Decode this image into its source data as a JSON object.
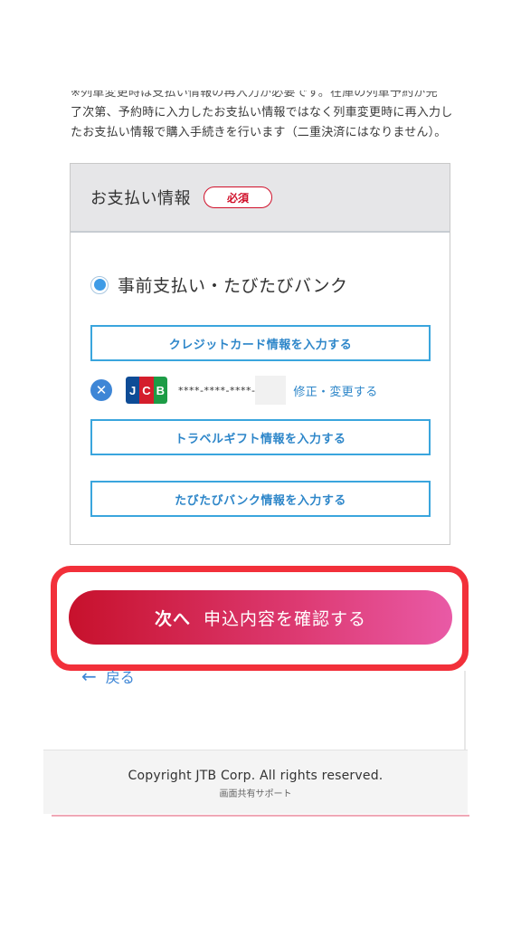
{
  "notice": {
    "line1": "※列車変更時は支払い情報の再入力が必要です。在庫の列車予約が完",
    "line2": "了次第、予約時に入力したお支払い情報ではなく列車変更時に再入力し",
    "line3": "たお支払い情報で購入手続きを行います（二重決済にはなりません）。"
  },
  "payment": {
    "title": "お支払い情報",
    "required_badge": "必須",
    "option_label": "事前支払い・たびたびバンク",
    "credit_button": "クレジットカード情報を入力する",
    "card": {
      "brand_letters": [
        "J",
        "C",
        "B"
      ],
      "number": "****-****-****-",
      "edit_link": "修正・変更する"
    },
    "gift_button": "トラベルギフト情報を入力する",
    "tabitabi_button": "たびたびバンク情報を入力する"
  },
  "actions": {
    "next_strong": "次へ",
    "next_label": "申込内容を確認する",
    "back_label": "戻る"
  },
  "footer": {
    "copyright": "Copyright JTB Corp. All rights reserved.",
    "support": "画面共有サポート"
  },
  "colors": {
    "accent_blue": "#3aa5dd",
    "required_red": "#d0102a",
    "highlight_red": "#f2303a",
    "next_gradient_start": "#c7112c",
    "next_gradient_end": "#e95aa6"
  }
}
